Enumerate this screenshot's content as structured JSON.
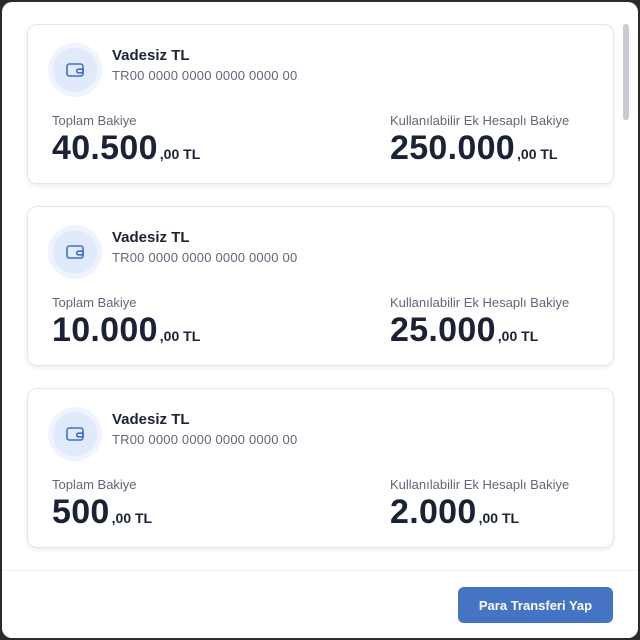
{
  "accounts": [
    {
      "title": "Vadesiz TL",
      "iban": "TR00 0000 0000 0000 0000 00",
      "total_label": "Toplam Bakiye",
      "total_int": "40.500",
      "total_dec": ",00 TL",
      "avail_label": "Kullanılabilir Ek Hesaplı Bakiye",
      "avail_int": "250.000",
      "avail_dec": ",00 TL"
    },
    {
      "title": "Vadesiz TL",
      "iban": "TR00 0000 0000 0000 0000 00",
      "total_label": "Toplam Bakiye",
      "total_int": "10.000",
      "total_dec": ",00 TL",
      "avail_label": "Kullanılabilir Ek Hesaplı Bakiye",
      "avail_int": "25.000",
      "avail_dec": ",00 TL"
    },
    {
      "title": "Vadesiz TL",
      "iban": "TR00 0000 0000 0000 0000 00",
      "total_label": "Toplam Bakiye",
      "total_int": "500",
      "total_dec": ",00 TL",
      "avail_label": "Kullanılabilir Ek Hesaplı Bakiye",
      "avail_int": "2.000",
      "avail_dec": ",00 TL"
    }
  ],
  "footer": {
    "transfer_button": "Para Transferi Yap"
  },
  "icons": {
    "account": "wallet-icon"
  },
  "colors": {
    "accent": "#4574c4",
    "icon_bg": "#e1eafb",
    "text": "#1b2235"
  }
}
